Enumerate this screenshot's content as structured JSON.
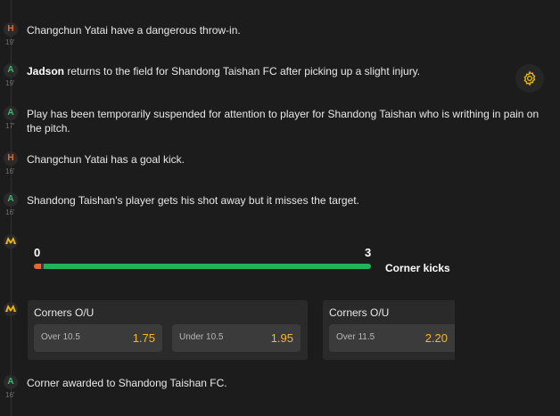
{
  "events": [
    {
      "type": "H",
      "minute": "19'",
      "text": "Changchun Yatai have a dangerous throw-in."
    },
    {
      "type": "A",
      "minute": "19'",
      "bold": "Jadson",
      "text": " returns to the field for Shandong Taishan FC after picking up a slight injury."
    },
    {
      "type": "A",
      "minute": "17'",
      "text": "Play has been temporarily suspended for attention to player for Shandong Taishan who is writhing in pain on the pitch."
    },
    {
      "type": "H",
      "minute": "16'",
      "text": "Changchun Yatai has a goal kick."
    },
    {
      "type": "A",
      "minute": "16'",
      "text": "Shandong Taishan's player gets his shot away but it misses the target."
    },
    {
      "type": "A",
      "minute": "16'",
      "text": "Corner awarded to Shandong Taishan FC."
    }
  ],
  "stat": {
    "label": "Corner kicks",
    "home_value": "0",
    "away_value": "3",
    "home_share": 0.02,
    "home_color": "#e8672b",
    "away_color": "#22b35a"
  },
  "markets": [
    {
      "title": "Corners O/U",
      "odds": [
        {
          "label": "Over 10.5",
          "value": "1.75"
        },
        {
          "label": "Under 10.5",
          "value": "1.95"
        }
      ]
    },
    {
      "title": "Corners O/U",
      "odds": [
        {
          "label": "Over 11.5",
          "value": "2.20"
        }
      ]
    }
  ],
  "icons": {
    "brand": "brand-logo-icon",
    "settings": "gear-icon"
  },
  "colors": {
    "home": "#e8672b",
    "away": "#3eb870",
    "brand": "#f0b90b",
    "odds": "#f5b82e"
  }
}
